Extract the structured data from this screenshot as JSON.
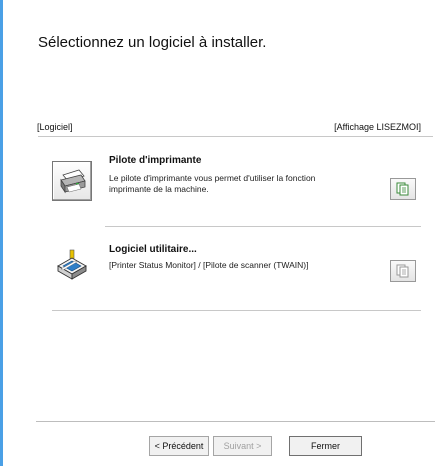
{
  "header": {
    "title": "Sélectionnez un logiciel à installer."
  },
  "list_header": {
    "left": "[Logiciel]",
    "right": "[Affichage LISEZMOI]"
  },
  "items": [
    {
      "title": "Pilote d'imprimante",
      "desc_line1": "Le pilote d'imprimante vous permet d'utiliser la fonction",
      "desc_line2": "imprimante de la machine.",
      "icon": "printer-icon"
    },
    {
      "title": "Logiciel utilitaire...",
      "desc_line1": "[Printer Status Monitor] / [Pilote de scanner (TWAIN)]",
      "icon": "scanner-icon"
    }
  ],
  "buttons": {
    "back": "< Précédent",
    "next": "Suivant >",
    "close": "Fermer"
  },
  "colors": {
    "window_accent": "#4aa0e6"
  }
}
